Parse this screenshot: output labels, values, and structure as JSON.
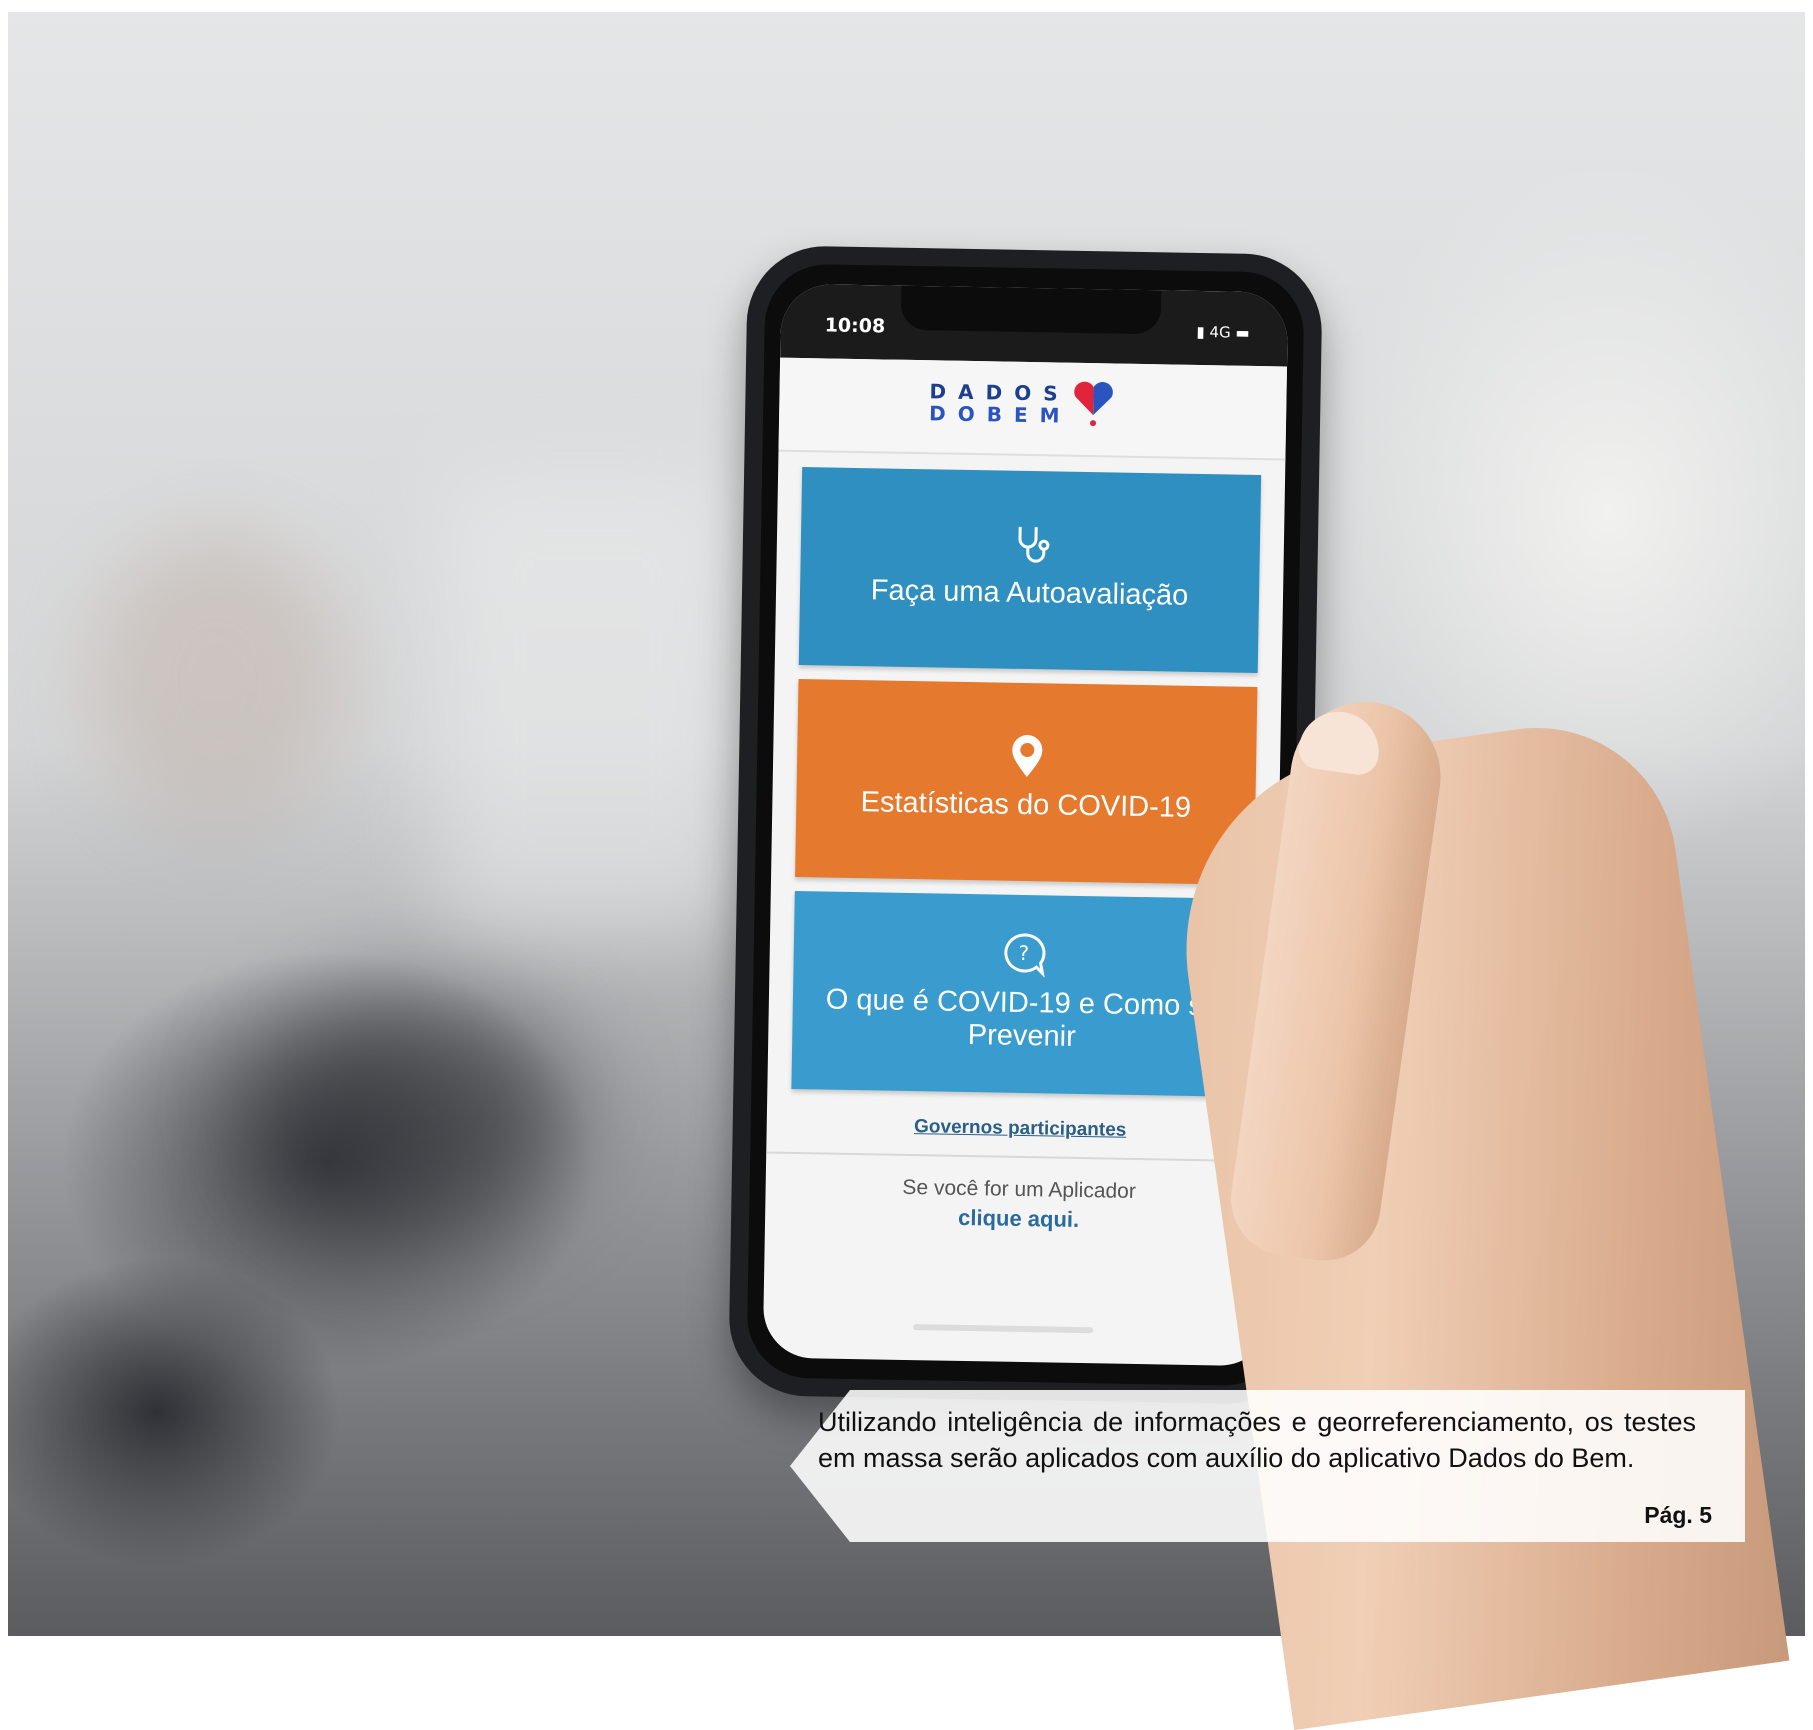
{
  "phone": {
    "status_time": "10:08",
    "status_network": "4G",
    "logo_line1": "DADOS",
    "logo_line2": "DOBEM",
    "cards": [
      {
        "label": "Faça uma Autoavaliação",
        "icon": "stethoscope-icon",
        "color": "#2f8fc0"
      },
      {
        "label": "Estatísticas do COVID-19",
        "icon": "location-pin-icon",
        "color": "#e57a2e"
      },
      {
        "label": "O que é COVID-19 e Como se Prevenir",
        "icon": "question-bubble-icon",
        "color": "#3a9cce"
      }
    ],
    "link_governos": "Governos participantes",
    "aplicador_text": "Se você for um Aplicador",
    "aplicador_link": "clique aqui."
  },
  "caption": {
    "text": "Utilizando inteligência de informações e georreferenciamento, os testes em massa serão aplicados com auxílio do aplicativo Dados do Bem.",
    "page_ref": "Pág. 5"
  }
}
